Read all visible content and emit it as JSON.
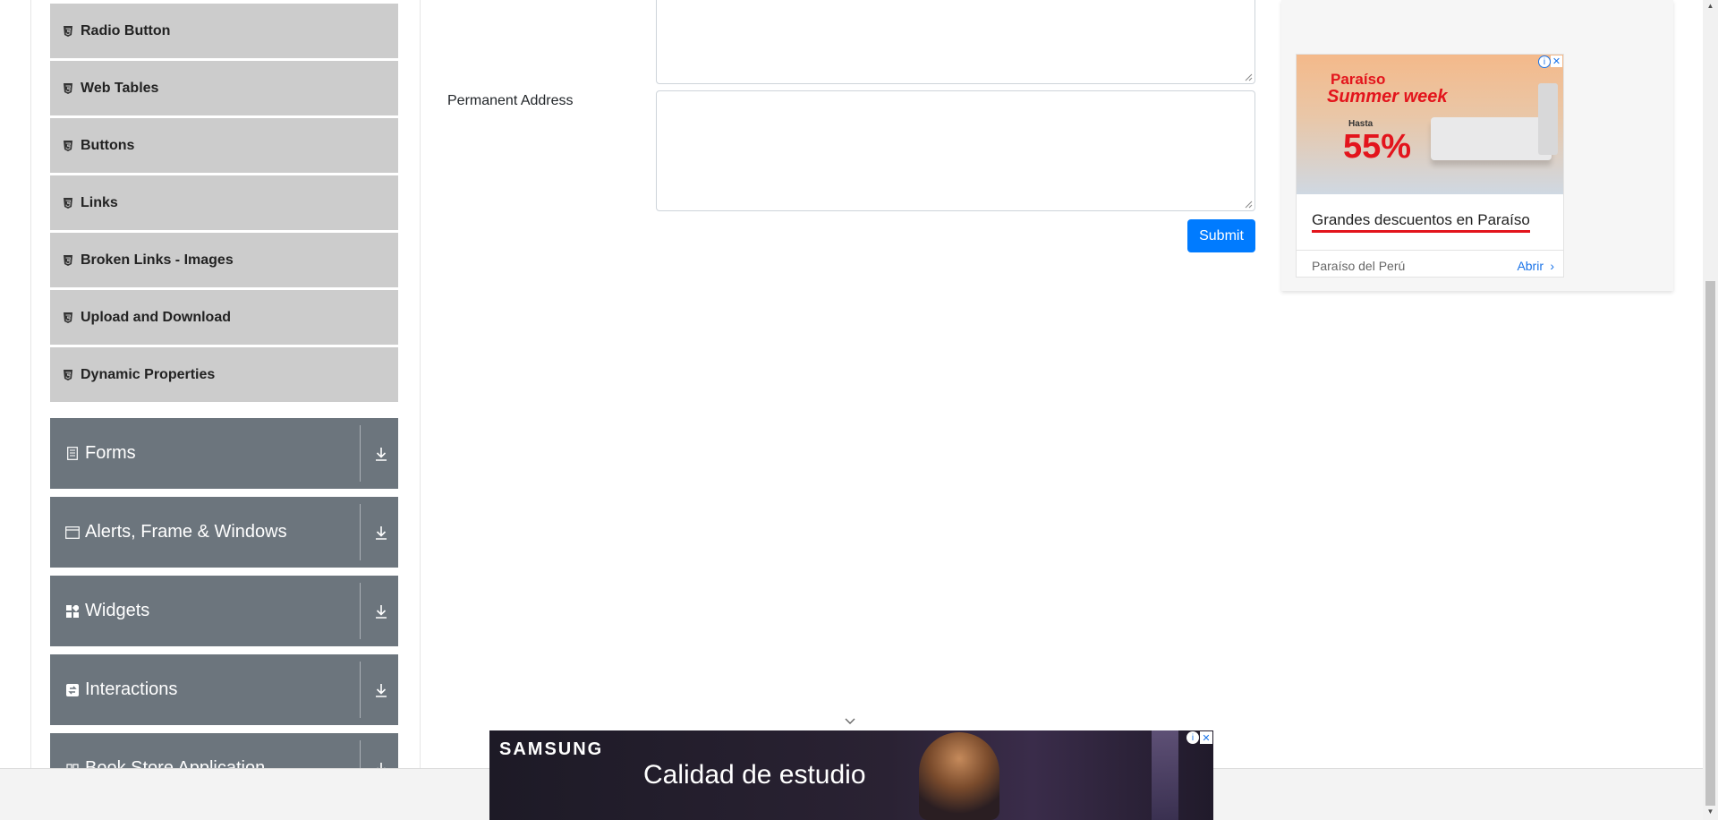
{
  "sidebar": {
    "elements_items": [
      {
        "label": "Radio Button"
      },
      {
        "label": "Web Tables"
      },
      {
        "label": "Buttons"
      },
      {
        "label": "Links"
      },
      {
        "label": "Broken Links - Images"
      },
      {
        "label": "Upload and Download"
      },
      {
        "label": "Dynamic Properties"
      }
    ],
    "groups": [
      {
        "label": "Forms",
        "icon": "form-icon"
      },
      {
        "label": "Alerts, Frame & Windows",
        "icon": "window-icon"
      },
      {
        "label": "Widgets",
        "icon": "widgets-icon"
      },
      {
        "label": "Interactions",
        "icon": "interactions-icon"
      },
      {
        "label": "Book Store Application",
        "icon": "book-icon"
      }
    ]
  },
  "form": {
    "permanent_address_label": "Permanent Address",
    "current_address_value": "",
    "permanent_address_value": "",
    "submit_label": "Submit"
  },
  "ad_right": {
    "brand": "Paraíso",
    "headline": "Summer week",
    "hasta": "Hasta",
    "percent": "55%",
    "link_text": "Grandes descuentos en Paraíso",
    "source": "Paraíso del Perú",
    "open_label": "Abrir",
    "accent": "#e3141c"
  },
  "ad_bottom": {
    "brand": "SAMSUNG",
    "title": "Calidad de estudio"
  },
  "colors": {
    "primary": "#007bff",
    "sidebar_group": "#6c757d",
    "sidebar_item": "#cccccc"
  }
}
